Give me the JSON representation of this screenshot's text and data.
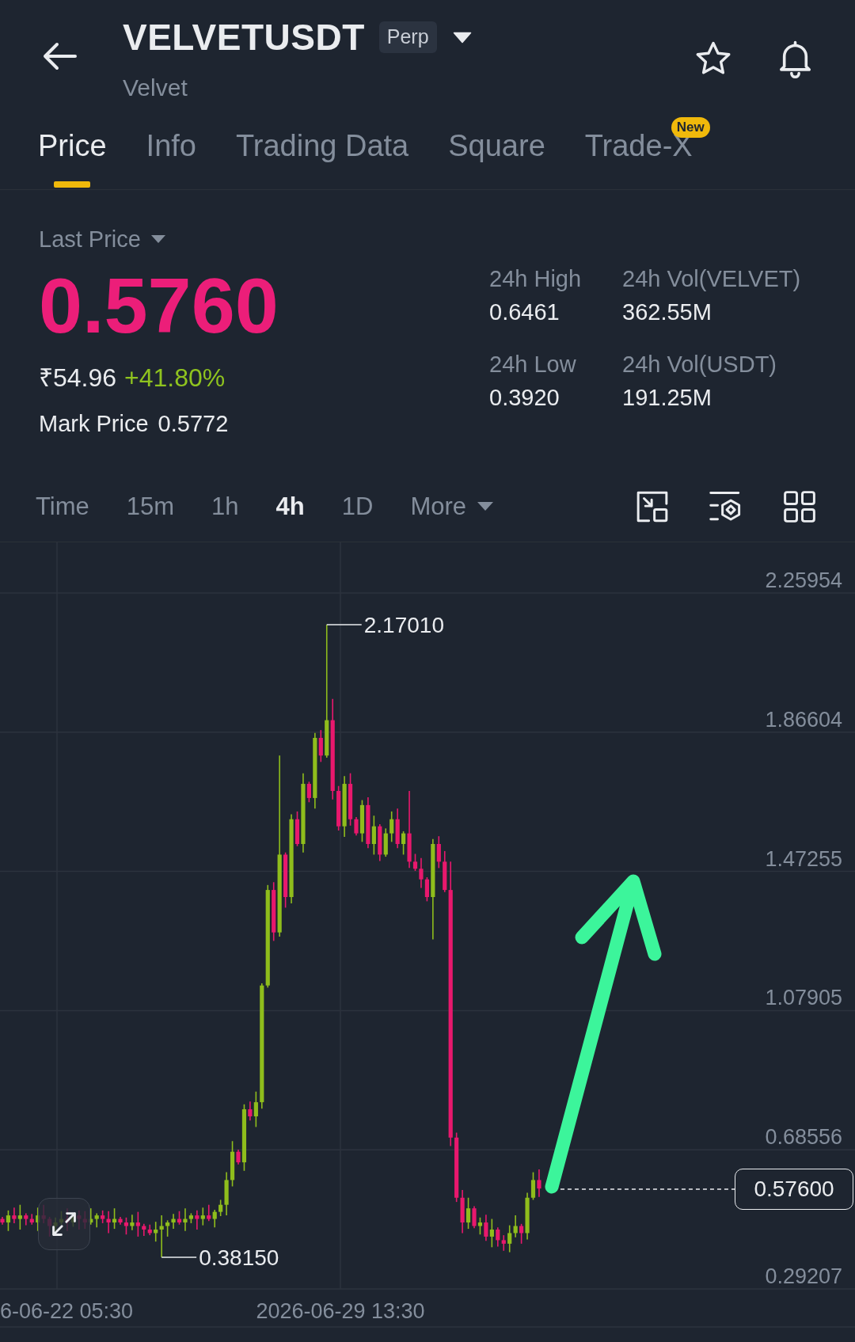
{
  "header": {
    "title": "VELVETUSDT",
    "badge": "Perp",
    "subtitle": "Velvet"
  },
  "tabs": [
    {
      "label": "Price",
      "selected": true
    },
    {
      "label": "Info",
      "selected": false
    },
    {
      "label": "Trading Data",
      "selected": false
    },
    {
      "label": "Square",
      "selected": false
    },
    {
      "label": "Trade-X",
      "selected": false,
      "badge": "New"
    }
  ],
  "price": {
    "label": "Last Price",
    "value": "0.5760",
    "falling": true,
    "fiat": "₹54.96",
    "change": "+41.80%",
    "change_rising": true,
    "mark_label": "Mark Price",
    "mark_value": "0.5772"
  },
  "stats": [
    {
      "label": "24h High",
      "value": "0.6461"
    },
    {
      "label": "24h Vol(VELVET)",
      "value": "362.55M"
    },
    {
      "label": "24h Low",
      "value": "0.3920"
    },
    {
      "label": "24h Vol(USDT)",
      "value": "191.25M"
    }
  ],
  "intervals": [
    {
      "label": "Time",
      "selected": false
    },
    {
      "label": "15m",
      "selected": false
    },
    {
      "label": "1h",
      "selected": false
    },
    {
      "label": "4h",
      "selected": true
    },
    {
      "label": "1D",
      "selected": false
    }
  ],
  "more": {
    "label": "More"
  },
  "chart": {
    "price_axis": [
      "2.25954",
      "1.86604",
      "1.47255",
      "1.07905",
      "0.68556",
      "0.29207"
    ],
    "high_label": "2.17010",
    "low_label": "0.38150",
    "last_price": "0.57600",
    "time_axis": [
      "6-06-22 05:30",
      "2026-06-29 13:30"
    ]
  }
}
